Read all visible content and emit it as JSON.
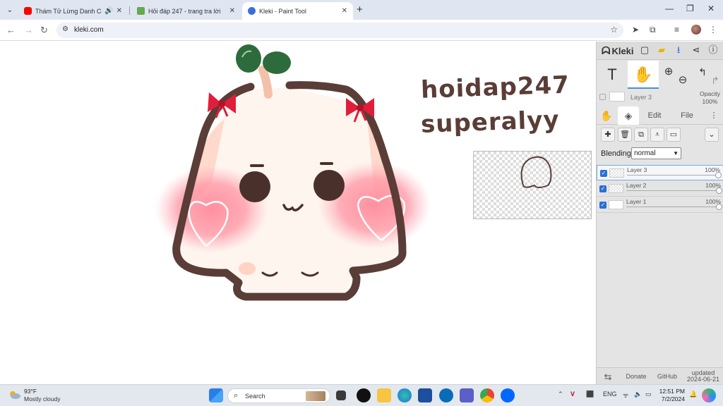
{
  "browser": {
    "tabs": [
      {
        "title": "Thám Tử Lừng Danh Conan",
        "favicon_color": "#ff0000",
        "audio_icon": "speaker-icon",
        "active": false
      },
      {
        "title": "Hỏi đáp 247 - trang tra lời",
        "favicon_color": "#6aa84f",
        "active": false
      },
      {
        "title": "Kleki - Paint Tool",
        "favicon_color": "#3b6fd8",
        "active": true
      }
    ],
    "url": "kleki.com",
    "colors": {
      "tabstrip": "#dfe6f2",
      "accent": "#1a73e8"
    }
  },
  "canvas": {
    "text_lines": [
      "hoidap247",
      "superalyy"
    ],
    "text_color": "#5a3d37",
    "drawing_icon": "cute-mochi-drawing"
  },
  "kleki": {
    "logo": "Kleki",
    "header_icons": [
      "new-file-icon",
      "open-folder-icon",
      "download-icon",
      "share-icon",
      "help-icon"
    ],
    "tools": [
      "text-tool-icon",
      "hand-tool-icon",
      "zoom-in-icon",
      "zoom-out-icon",
      "undo-icon",
      "redo-icon"
    ],
    "active_layer_name": "Layer 3",
    "opacity_label": "Opacity",
    "opacity_value": "100%",
    "tabs": {
      "edit": "Edit",
      "file": "File"
    },
    "blending_label": "Blending",
    "blending_value": "normal",
    "layers": [
      {
        "name": "Layer 3",
        "opacity": "100%",
        "selected": true
      },
      {
        "name": "Layer 2",
        "opacity": "100%",
        "selected": false
      },
      {
        "name": "Layer 1",
        "opacity": "100%",
        "selected": false
      }
    ],
    "footer": {
      "donate": "Donate",
      "github": "GitHub",
      "updated_label": "updated",
      "updated_date": "2024-06-21"
    }
  },
  "taskbar": {
    "weather_temp": "93°F",
    "weather_desc": "Mostly cloudy",
    "search_label": "Search",
    "lang": "ENG",
    "time": "12:51 PM",
    "date": "7/2/2024"
  }
}
